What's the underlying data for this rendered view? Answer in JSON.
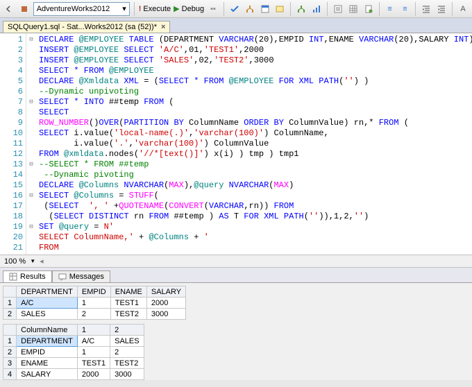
{
  "toolbar": {
    "database": "AdventureWorks2012",
    "execute": "Execute",
    "debug": "Debug"
  },
  "filetab": {
    "label": "SQLQuery1.sql - Sat...Works2012 (sa (52))*"
  },
  "code": {
    "lines": [
      {
        "n": 1,
        "fold": "⊟",
        "seg": [
          [
            "kw",
            "DECLARE "
          ],
          [
            "sys",
            "@EMPLOYEE"
          ],
          [
            "kw",
            " TABLE"
          ],
          [
            "",
            " (DEPARTMENT "
          ],
          [
            "kw",
            "VARCHAR"
          ],
          [
            "",
            "(20),EMPID "
          ],
          [
            "kw",
            "INT"
          ],
          [
            "",
            ",ENAME "
          ],
          [
            "kw",
            "VARCHAR"
          ],
          [
            "",
            "(20),SALARY "
          ],
          [
            "kw",
            "INT"
          ],
          [
            "",
            ")"
          ]
        ]
      },
      {
        "n": 2,
        "fold": "",
        "seg": [
          [
            "kw",
            "INSERT "
          ],
          [
            "sys",
            "@EMPLOYEE"
          ],
          [
            "kw",
            " SELECT"
          ],
          [
            "",
            " "
          ],
          [
            "str",
            "'A/C'"
          ],
          [
            "",
            ",01,"
          ],
          [
            "str",
            "'TEST1'"
          ],
          [
            "",
            ",2000"
          ]
        ]
      },
      {
        "n": 3,
        "fold": "",
        "seg": [
          [
            "kw",
            "INSERT "
          ],
          [
            "sys",
            "@EMPLOYEE"
          ],
          [
            "kw",
            " SELECT"
          ],
          [
            "",
            " "
          ],
          [
            "str",
            "'SALES'"
          ],
          [
            "",
            ",02,"
          ],
          [
            "str",
            "'TEST2'"
          ],
          [
            "",
            ",3000"
          ]
        ]
      },
      {
        "n": 4,
        "fold": "",
        "seg": [
          [
            "kw",
            "SELECT * FROM "
          ],
          [
            "sys",
            "@EMPLOYEE"
          ]
        ]
      },
      {
        "n": 5,
        "fold": "",
        "seg": [
          [
            "kw",
            "DECLARE "
          ],
          [
            "sys",
            "@Xmldata"
          ],
          [
            "",
            " "
          ],
          [
            "kw",
            "XML"
          ],
          [
            "",
            " = ("
          ],
          [
            "kw",
            "SELECT * FROM "
          ],
          [
            "sys",
            "@EMPLOYEE"
          ],
          [
            "kw",
            " FOR XML PATH"
          ],
          [
            "",
            "("
          ],
          [
            "str",
            "''"
          ],
          [
            "",
            ") )"
          ]
        ]
      },
      {
        "n": 6,
        "fold": "",
        "seg": [
          [
            "cmt",
            "--Dynamic unpivoting"
          ]
        ]
      },
      {
        "n": 7,
        "fold": "⊟",
        "seg": [
          [
            "kw",
            "SELECT * INTO"
          ],
          [
            "",
            " ##temp "
          ],
          [
            "kw",
            "FROM"
          ],
          [
            "",
            " ("
          ]
        ]
      },
      {
        "n": 8,
        "fold": "",
        "seg": [
          [
            "kw",
            "SELECT"
          ]
        ]
      },
      {
        "n": 9,
        "fold": "",
        "seg": [
          [
            "fn",
            "ROW_NUMBER"
          ],
          [
            "",
            "()"
          ],
          [
            "kw",
            "OVER"
          ],
          [
            "",
            "("
          ],
          [
            "kw",
            "PARTITION BY"
          ],
          [
            "",
            " ColumnName "
          ],
          [
            "kw",
            "ORDER BY"
          ],
          [
            "",
            " ColumnValue) rn,* "
          ],
          [
            "kw",
            "FROM"
          ],
          [
            "",
            " ("
          ]
        ]
      },
      {
        "n": 10,
        "fold": "",
        "seg": [
          [
            "kw",
            "SELECT"
          ],
          [
            "",
            " i.value("
          ],
          [
            "str",
            "'local-name(.)'"
          ],
          [
            "",
            ","
          ],
          [
            "str",
            "'varchar(100)'"
          ],
          [
            "",
            ") ColumnName,"
          ]
        ]
      },
      {
        "n": 11,
        "fold": "",
        "seg": [
          [
            "",
            "       i.value("
          ],
          [
            "str",
            "'.'"
          ],
          [
            "",
            ","
          ],
          [
            "str",
            "'varchar(100)'"
          ],
          [
            "",
            ") ColumnValue"
          ]
        ]
      },
      {
        "n": 12,
        "fold": "",
        "seg": [
          [
            "kw",
            "FROM "
          ],
          [
            "sys",
            "@xmldata"
          ],
          [
            "",
            ".nodes("
          ],
          [
            "str",
            "'//*[text()]'"
          ],
          [
            "",
            ") x(i) ) tmp ) tmp1"
          ]
        ]
      },
      {
        "n": 13,
        "fold": "⊟",
        "seg": [
          [
            "cmt",
            "--SELECT * FROM ##temp"
          ]
        ]
      },
      {
        "n": 14,
        "fold": "",
        "seg": [
          [
            "cmt",
            " --Dynamic pivoting"
          ]
        ]
      },
      {
        "n": 15,
        "fold": "",
        "seg": [
          [
            "kw",
            "DECLARE "
          ],
          [
            "sys",
            "@Columns"
          ],
          [
            "",
            " "
          ],
          [
            "kw",
            "NVARCHAR"
          ],
          [
            "",
            "("
          ],
          [
            "fn",
            "MAX"
          ],
          [
            "",
            "),"
          ],
          [
            "sys",
            "@query"
          ],
          [
            "",
            " "
          ],
          [
            "kw",
            "NVARCHAR"
          ],
          [
            "",
            "("
          ],
          [
            "fn",
            "MAX"
          ],
          [
            "",
            ")"
          ]
        ]
      },
      {
        "n": 16,
        "fold": "⊟",
        "seg": [
          [
            "kw",
            "SELECT "
          ],
          [
            "sys",
            "@Columns"
          ],
          [
            "",
            " = "
          ],
          [
            "fn",
            "STUFF"
          ],
          [
            "",
            "("
          ]
        ]
      },
      {
        "n": 17,
        "fold": "",
        "seg": [
          [
            "",
            " ("
          ],
          [
            "kw",
            "SELECT"
          ],
          [
            "",
            "  "
          ],
          [
            "str",
            "', '"
          ],
          [
            "",
            " +"
          ],
          [
            "fn",
            "QUOTENAME"
          ],
          [
            "",
            "("
          ],
          [
            "fn",
            "CONVERT"
          ],
          [
            "",
            "("
          ],
          [
            "kw",
            "VARCHAR"
          ],
          [
            "",
            ",rn)) "
          ],
          [
            "kw",
            "FROM"
          ]
        ]
      },
      {
        "n": 18,
        "fold": "",
        "seg": [
          [
            "",
            "  ("
          ],
          [
            "kw",
            "SELECT DISTINCT"
          ],
          [
            "",
            " rn "
          ],
          [
            "kw",
            "FROM"
          ],
          [
            "",
            " ##temp ) "
          ],
          [
            "kw",
            "AS"
          ],
          [
            "",
            " T "
          ],
          [
            "kw",
            "FOR XML PATH"
          ],
          [
            "",
            "("
          ],
          [
            "str",
            "''"
          ],
          [
            "",
            ")),1,2,"
          ],
          [
            "str",
            "''"
          ],
          [
            "",
            ")"
          ]
        ]
      },
      {
        "n": 19,
        "fold": "⊟",
        "seg": [
          [
            "kw",
            "SET "
          ],
          [
            "sys",
            "@query"
          ],
          [
            "",
            " = "
          ],
          [
            "str",
            "N'"
          ]
        ]
      },
      {
        "n": 20,
        "fold": "",
        "seg": [
          [
            "str",
            "SELECT ColumnName,'"
          ],
          [
            "",
            " + "
          ],
          [
            "sys",
            "@Columns"
          ],
          [
            "",
            " + "
          ],
          [
            "str",
            "'"
          ]
        ]
      },
      {
        "n": 21,
        "fold": "",
        "seg": [
          [
            "str",
            "FROM"
          ]
        ]
      }
    ]
  },
  "zoom": {
    "value": "100 %"
  },
  "resultsTabs": {
    "results": "Results",
    "messages": "Messages"
  },
  "grid1": {
    "headers": [
      "",
      "DEPARTMENT",
      "EMPID",
      "ENAME",
      "SALARY"
    ],
    "rows": [
      [
        "1",
        "A/C",
        "1",
        "TEST1",
        "2000"
      ],
      [
        "2",
        "SALES",
        "2",
        "TEST2",
        "3000"
      ]
    ]
  },
  "grid2": {
    "headers": [
      "",
      "ColumnName",
      "1",
      "2"
    ],
    "rows": [
      [
        "1",
        "DEPARTMENT",
        "A/C",
        "SALES"
      ],
      [
        "2",
        "EMPID",
        "1",
        "2"
      ],
      [
        "3",
        "ENAME",
        "TEST1",
        "TEST2"
      ],
      [
        "4",
        "SALARY",
        "2000",
        "3000"
      ]
    ]
  }
}
